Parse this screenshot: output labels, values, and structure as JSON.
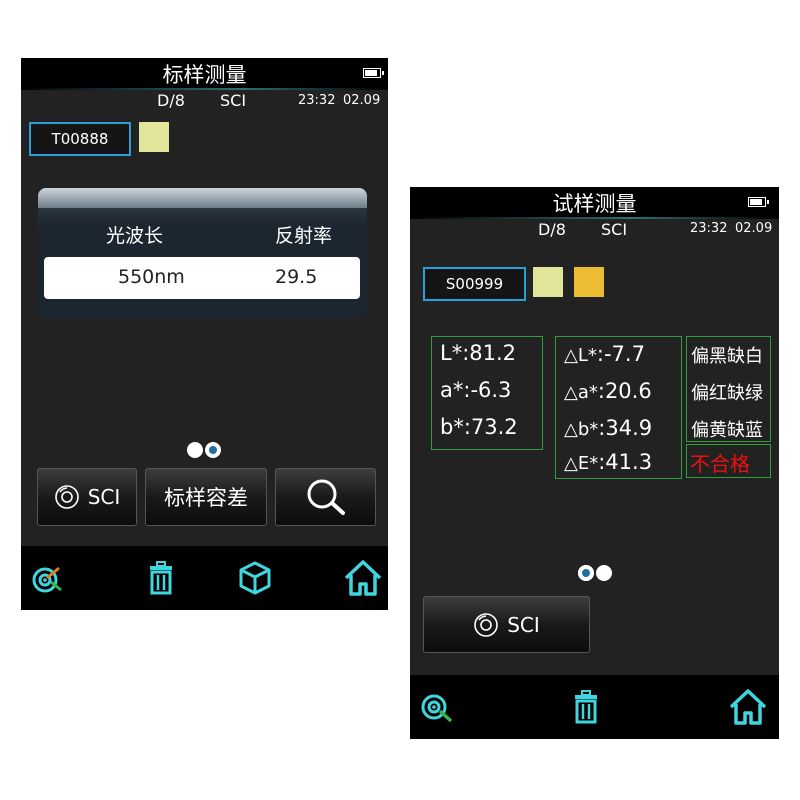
{
  "colors": {
    "cyan_icon": "#3fd6e0",
    "swatch_yellow": "#e1e59a",
    "swatch_orange": "#ecbd32",
    "fail_red": "#ee1111",
    "grid_green": "#2ea03a",
    "id_border": "#2a9fd6"
  },
  "left_screen": {
    "title": "标样测量",
    "geometry": "D/8",
    "mode": "SCI",
    "time": "23:32",
    "date": "02.09",
    "standard_id": "T00888",
    "table": {
      "col1_header": "光波长",
      "col2_header": "反射率",
      "wavelength": "550nm",
      "reflectance": "29.5"
    },
    "buttons": {
      "sci_label": "SCI",
      "tolerance_label": "标样容差"
    },
    "footer_icons": [
      "target-icon",
      "trash-icon",
      "cube-icon",
      "home-icon"
    ]
  },
  "right_screen": {
    "title": "试样测量",
    "geometry": "D/8",
    "mode": "SCI",
    "time": "23:32",
    "date": "02.09",
    "sample_id": "S00999",
    "lab": {
      "L": "L*:81.2",
      "a": "a*:-6.3",
      "b": "b*:73.2"
    },
    "delta": {
      "dL_pre": "△L*",
      "dL_val": ":-7.7",
      "da_pre": "△a*",
      "da_val": ":20.6",
      "db_pre": "△b*",
      "db_val": ":34.9",
      "dE_pre": "△E*",
      "dE_val": ":41.3"
    },
    "remarks": {
      "L": "偏黑缺白",
      "a": "偏红缺绿",
      "b": "偏黄缺蓝"
    },
    "verdict": "不合格",
    "buttons": {
      "sci_label": "SCI"
    },
    "footer_icons": [
      "target-icon",
      "trash-icon",
      "home-icon"
    ]
  }
}
